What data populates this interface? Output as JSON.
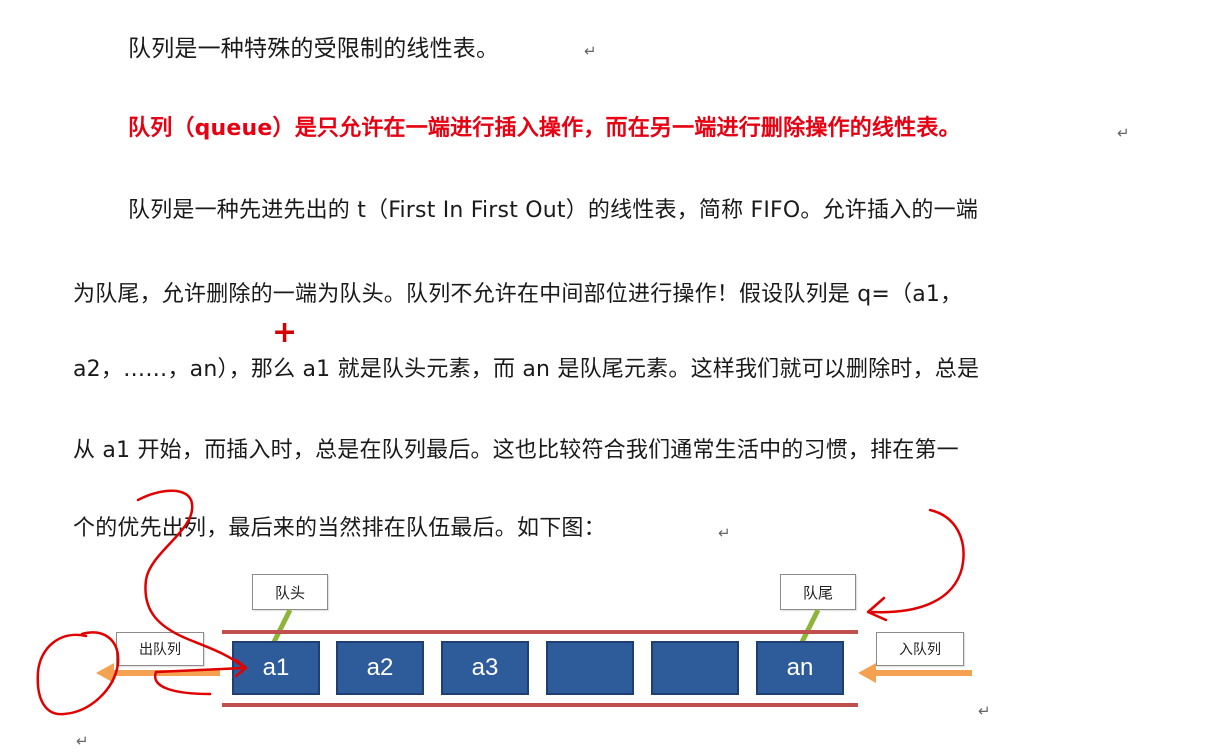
{
  "paragraphs": {
    "line1": "队列是一种特殊的受限制的线性表。",
    "line2": "队列（queue）是只允许在一端进行插入操作，而在另一端进行删除操作的线性表。",
    "line3": "队列是一种先进先出的 t（First In First Out）的线性表，简称 FIFO。允许插入的一端",
    "line4": "为队尾，允许删除的一端为队头。队列不允许在中间部位进行操作！假设队列是 q=（a1，",
    "line5": "a2，……，an），那么 a1 就是队头元素，而 an 是队尾元素。这样我们就可以删除时，总是",
    "line6": "从 a1 开始，而插入时，总是在队列最后。这也比较符合我们通常生活中的习惯，排在第一",
    "line7": "个的优先出列，最后来的当然排在队伍最后。如下图："
  },
  "marks": {
    "paragraph_return": "↵",
    "cursor": "+"
  },
  "diagram": {
    "head_label": "队头",
    "tail_label": "队尾",
    "dequeue_label": "出队列",
    "enqueue_label": "入队列",
    "cells": [
      "a1",
      "a2",
      "a3",
      "",
      "",
      "an"
    ],
    "colors": {
      "cell": "#2e5c9a",
      "rail": "#c0504d",
      "arrow": "#f4a252",
      "pointer": "#8db53c",
      "ink": "#e00000"
    }
  }
}
